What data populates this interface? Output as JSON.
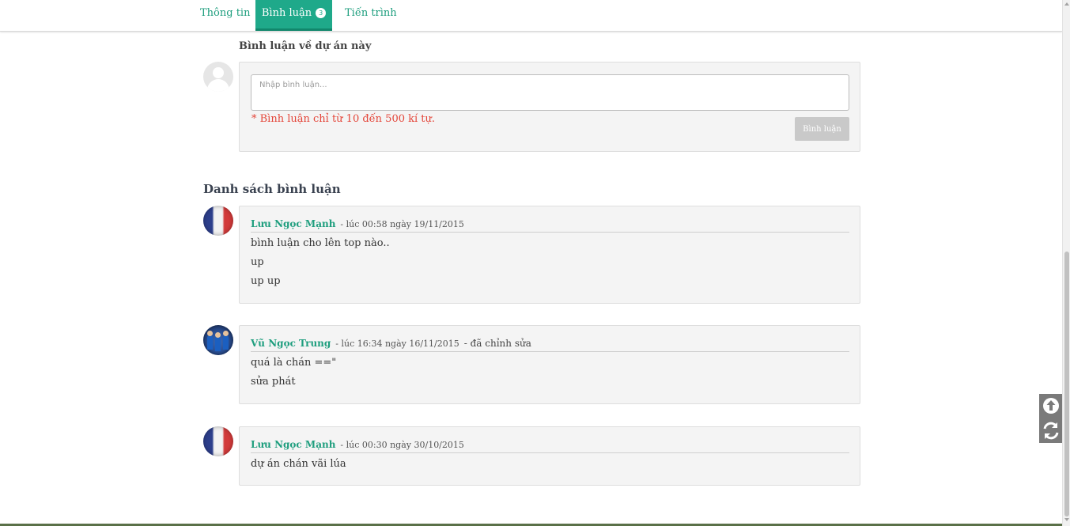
{
  "tabs": [
    {
      "label": "Thông tin"
    },
    {
      "label": "Bình luận",
      "badge": "3"
    },
    {
      "label": "Tiến trình"
    }
  ],
  "form": {
    "title": "Bình luận về dự án này",
    "placeholder": "Nhập bình luận...",
    "note": "* Bình luận chỉ từ 10 đến 500 kí tự.",
    "submit_label": "Bình luận"
  },
  "list_title": "Danh sách bình luận",
  "comments": [
    {
      "author": "Lưu Ngọc Mạnh",
      "meta": "- lúc 00:58 ngày 19/11/2015",
      "edited": "",
      "lines": [
        "bình luận cho lên top nào..",
        "up",
        "up up"
      ]
    },
    {
      "author": "Vũ Ngọc Trung",
      "meta": "- lúc 16:34 ngày 16/11/2015",
      "edited": "- đã chỉnh sửa",
      "lines": [
        "quá là chán ==\"",
        "sửa phát"
      ]
    },
    {
      "author": "Lưu Ngọc Mạnh",
      "meta": "- lúc 00:30 ngày 30/10/2015",
      "edited": "",
      "lines": [
        "dự án chán vãi lúa"
      ]
    }
  ],
  "icons": {
    "scroll_top": "arrow-circle-up-icon",
    "refresh": "refresh-icon"
  },
  "colors": {
    "accent": "#1fa98a",
    "link": "#1e9e7e",
    "warning": "#e4463a"
  }
}
